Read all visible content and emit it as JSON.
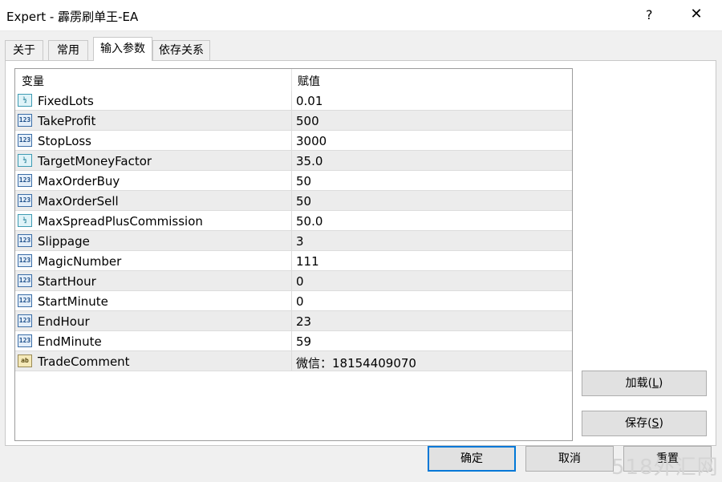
{
  "window": {
    "title": "Expert - 霹雳刷单王-EA",
    "help_label": "?",
    "close_label": "✕"
  },
  "tabs": [
    {
      "label": "关于"
    },
    {
      "label": "常用"
    },
    {
      "label": "输入参数"
    },
    {
      "label": "依存关系"
    }
  ],
  "active_tab": "输入参数",
  "table": {
    "col_variable": "变量",
    "col_value": "赋值",
    "rows": [
      {
        "icon": "double-type-icon",
        "name": "FixedLots",
        "value": "0.01"
      },
      {
        "icon": "int-type-icon",
        "name": "TakeProfit",
        "value": "500"
      },
      {
        "icon": "int-type-icon",
        "name": "StopLoss",
        "value": "3000"
      },
      {
        "icon": "double-type-icon",
        "name": "TargetMoneyFactor",
        "value": "35.0"
      },
      {
        "icon": "int-type-icon",
        "name": "MaxOrderBuy",
        "value": "50"
      },
      {
        "icon": "int-type-icon",
        "name": "MaxOrderSell",
        "value": "50"
      },
      {
        "icon": "double-type-icon",
        "name": "MaxSpreadPlusCommission",
        "value": "50.0"
      },
      {
        "icon": "int-type-icon",
        "name": "Slippage",
        "value": "3"
      },
      {
        "icon": "int-type-icon",
        "name": "MagicNumber",
        "value": "111"
      },
      {
        "icon": "int-type-icon",
        "name": "StartHour",
        "value": "0"
      },
      {
        "icon": "int-type-icon",
        "name": "StartMinute",
        "value": "0"
      },
      {
        "icon": "int-type-icon",
        "name": "EndHour",
        "value": "23"
      },
      {
        "icon": "int-type-icon",
        "name": "EndMinute",
        "value": "59"
      },
      {
        "icon": "string-type-icon",
        "name": "TradeComment",
        "value": "微信：18154409070"
      }
    ]
  },
  "icons": {
    "int_glyph": "123",
    "double_glyph": "½",
    "string_glyph": "ab"
  },
  "buttons": {
    "load_text": "加载(",
    "load_key": "L",
    "load_end": ")",
    "save_text": "保存(",
    "save_key": "S",
    "save_end": ")",
    "ok": "确定",
    "cancel": "取消",
    "reset": "重置"
  },
  "watermark": "518外汇网"
}
